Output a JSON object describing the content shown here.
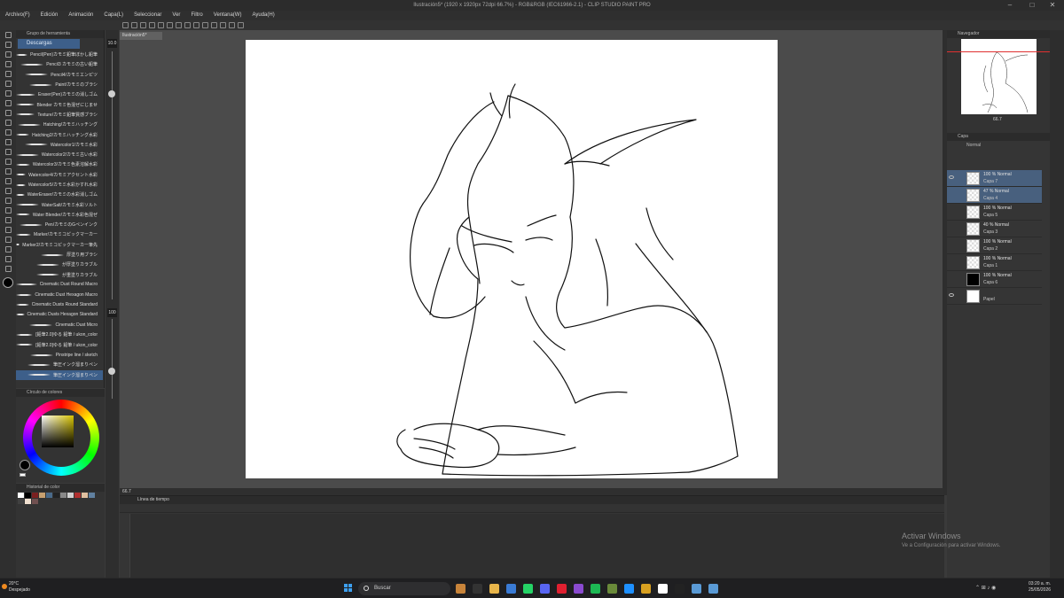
{
  "window": {
    "title": "Ilustración5* (1920 x 1920px 72dpi 66.7%) - RGB&RGB (IEC61966-2.1) - CLIP STUDIO PAINT PRO"
  },
  "menu": [
    "Archivo(F)",
    "Edición",
    "Animación",
    "Capa(L)",
    "Seleccionar",
    "Ver",
    "Filtro",
    "Ventana(W)",
    "Ayuda(H)"
  ],
  "subtool": {
    "group_title": "Grupo de herramienta",
    "tab_label": "Descargas",
    "brushes": [
      "Pencil(Pen)カモミ鉛筆ぼかし鉛筆",
      "Pencil3 カモミの古い鉛筆",
      "Pencil4/カモミエンピツ",
      "Paint/カモミのブラシ",
      "Eraser(Pen)カモミの消しゴム",
      "Blender カモミ色混ぜにじませ",
      "Texture/カモミ鉛筆質感ブラシ",
      "Hatching/カモミハッチング",
      "Hatching2/カモミハッチング水彩",
      "Watercolor1/カモミ水彩",
      "Watercolor2/カモミ古い水彩",
      "Watercolor3/カモミ色素溶解水彩",
      "Watercolor4/カモミアクセント水彩",
      "Watercolor5/カモミ水彩かすれ水彩",
      "WaterEraser/カモミの水彩消しゴム",
      "WaterSalt/カモミ水彩ソルト",
      "Water Blender/カモミ水彩色混ぜ",
      "Pen/カモミのGペンインク",
      "Marker/カモミコピックマーカー",
      "Marker2/カモミコピックマーカー筆先",
      "厚塗り用ブラシ",
      "が厚塗りカラブル",
      "が重塗りカラブル",
      "Cinematic Dust Round Macro",
      "Cinematic Dust Hexagon Macro",
      "Cinematic Dusts Round Standard",
      "Cinematic Dusts Hexagon Standard",
      "Cinematic Dust Micro",
      "[鉛筆2.0]ゆる 鉛筆 / ukon_color",
      "[鉛筆2.0]ゆる 鉛筆 / ukon_color",
      "Pinstripe line / sketch",
      "筆圧インク溜まりペン",
      "筆圧インク溜まりペン"
    ],
    "selected_index": 32
  },
  "brush_size": {
    "top_value": "10.0",
    "bottom_value": "100",
    "size_level": 0.17,
    "opacity_level": 0.65
  },
  "color_wheel": {
    "title": "Círculo de colores",
    "main_color": "#000000",
    "sub_color": "#ffffff"
  },
  "color_history": {
    "title": "Historial de color",
    "swatches": [
      "#ffffff",
      "#000000",
      "#7a2020",
      "#c7a070",
      "#4a6a8a",
      "#222222",
      "#888888",
      "#d0d0d0",
      "#b03030",
      "#e0c0a0",
      "#6080a0",
      "#404040",
      "#f0e0d0",
      "#705050"
    ]
  },
  "canvas": {
    "doc_tab": "Ilustración5*",
    "zoom": "66.7"
  },
  "timeline": {
    "title": "Línea de tiempo"
  },
  "navigator": {
    "title": "Navegador",
    "zoom": "66.7"
  },
  "layers": {
    "title": "Capa",
    "blend": "Normal",
    "items": [
      {
        "mode": "100 % Normal",
        "name": "Capa 7",
        "selected": true,
        "visible": true,
        "thumb": "transparent"
      },
      {
        "mode": "47 % Normal",
        "name": "Capa 4",
        "selected": true,
        "visible": false,
        "thumb": "transparent"
      },
      {
        "mode": "100 % Normal",
        "name": "Capa 5",
        "selected": false,
        "visible": false,
        "thumb": "transparent"
      },
      {
        "mode": "40 % Normal",
        "name": "Capa 3",
        "selected": false,
        "visible": false,
        "thumb": "transparent"
      },
      {
        "mode": "100 % Normal",
        "name": "Capa 2",
        "selected": false,
        "visible": false,
        "thumb": "transparent"
      },
      {
        "mode": "100 % Normal",
        "name": "Capa 1",
        "selected": false,
        "visible": false,
        "thumb": "transparent"
      },
      {
        "mode": "100 % Normal",
        "name": "Capa 6",
        "selected": false,
        "visible": false,
        "thumb": "black"
      },
      {
        "mode": "",
        "name": "Papel",
        "selected": false,
        "visible": true,
        "thumb": "white"
      }
    ]
  },
  "watermark": {
    "line1": "Activar Windows",
    "line2": "Ve a Configuración para activar Windows."
  },
  "taskbar": {
    "temp": "20°C",
    "weather": "Despejado",
    "search_placeholder": "Buscar",
    "time": "03:20 a. m.",
    "date": "25/05/2026"
  }
}
